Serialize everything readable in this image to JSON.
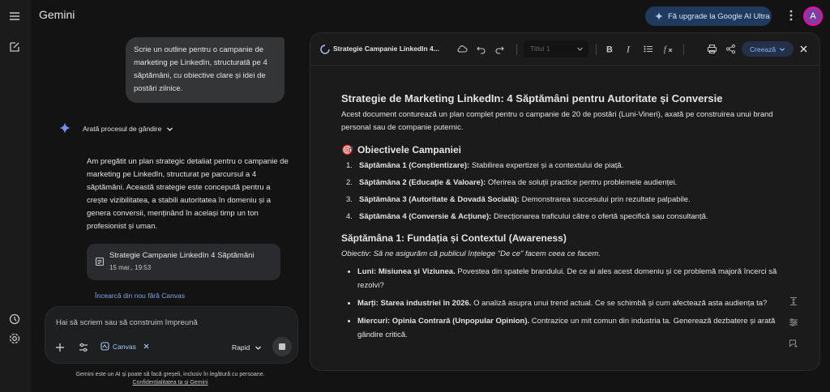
{
  "app": {
    "title": "Gemini"
  },
  "rail": {
    "icons": [
      "menu-icon",
      "new-chat-icon",
      "history-icon",
      "settings-icon"
    ]
  },
  "header": {
    "upgrade_label": "Fă upgrade la Google AI Ultra",
    "avatar_letter": "A"
  },
  "chat": {
    "user_message": "Scrie un outline pentru o campanie de marketing pe LinkedIn, structurată pe 4 săptămâni, cu obiective clare și idei de postări zilnice.",
    "thinking_label": "Arată procesul de gândire",
    "answer": "Am pregătit un plan strategic detaliat pentru o campanie de marketing pe LinkedIn, structurat pe parcursul a 4 săptămâni. Această strategie este concepută pentru a crește vizibilitatea, a stabili autoritatea în domeniu și a genera conversii, menținând în același timp un ton profesionist și uman.",
    "doc_card": {
      "title": "Strategie Campanie LinkedIn 4 Săptămâni",
      "date": "15 mar., 19:53"
    },
    "retry_label": "Încearcă din nou fără Canvas"
  },
  "composer": {
    "placeholder": "Hai să scriem sau să construim împreună",
    "canvas_chip": "Canvas",
    "model_label": "Rapid"
  },
  "disclaimer": {
    "text": "Gemini este un AI și poate să facă greșeli, inclusiv în legătură cu persoane.",
    "link": "Confidențialitatea ta și Gemini"
  },
  "canvas": {
    "toolbar": {
      "title": "Strategie Campanie LinkedIn 4...",
      "style_select": "Titlul 1",
      "create_label": "Creează"
    },
    "doc": {
      "h1": "Strategie de Marketing LinkedIn: 4 Săptămâni pentru Autoritate și Conversie",
      "intro": "Acest document conturează un plan complet pentru o campanie de 20 de postări (Luni-Vineri), axată pe construirea unui brand personal sau de companie puternic.",
      "objectives_emoji": "🎯",
      "objectives_title": "Obiectivele Campaniei",
      "objectives": [
        {
          "num": "1.",
          "bold": "Săptămâna 1 (Conștientizare):",
          "text": " Stabilirea expertizei și a contextului de piață."
        },
        {
          "num": "2.",
          "bold": "Săptămâna 2 (Educație & Valoare):",
          "text": " Oferirea de soluții practice pentru problemele audienței."
        },
        {
          "num": "3.",
          "bold": "Săptămâna 3 (Autoritate & Dovadă Socială):",
          "text": " Demonstrarea succesului prin rezultate palpabile."
        },
        {
          "num": "4.",
          "bold": "Săptămâna 4 (Conversie & Acțiune):",
          "text": " Direcționarea traficului către o ofertă specifică sau consultanță."
        }
      ],
      "week1_title": "Săptămâna 1: Fundația și Contextul (Awareness)",
      "week1_objective": "Obiectiv: Să ne asigurăm că publicul înțelege \"De ce\" facem ceea ce facem.",
      "week1_days": [
        {
          "bold": "Luni: Misiunea și Viziunea.",
          "text": " Povestea din spatele brandului. De ce ai ales acest domeniu și ce problemă majoră încerci să rezolvi?"
        },
        {
          "bold": "Marți: Starea industriei în 2026.",
          "text": " O analiză asupra unui trend actual. Ce se schimbă și cum afectează asta audiența ta?"
        },
        {
          "bold": "Miercuri: Opinia Contrară (Unpopular Opinion).",
          "text": " Contrazice un mit comun din industria ta. Generează dezbatere și arată gândire critică."
        }
      ]
    }
  }
}
